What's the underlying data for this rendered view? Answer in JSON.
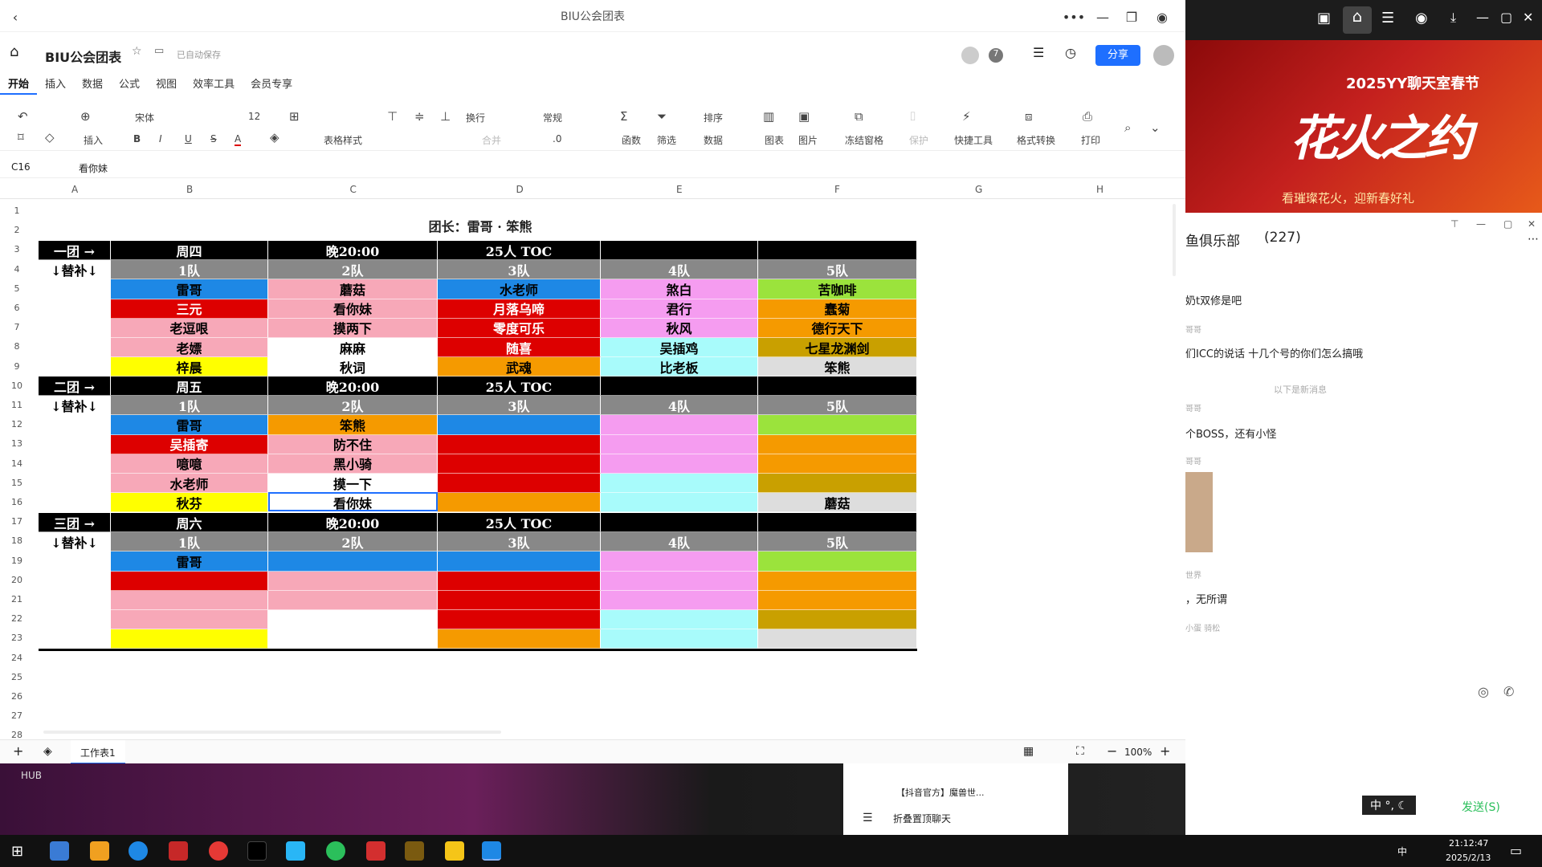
{
  "window": {
    "title": "BIU公会团表"
  },
  "doc": {
    "name": "BIU公会团表",
    "save_status": "已自动保存",
    "share_label": "分享",
    "collab_count": "7"
  },
  "menu": [
    "开始",
    "插入",
    "数据",
    "公式",
    "视图",
    "效率工具",
    "会员专享"
  ],
  "toolbar": {
    "insert": "插入",
    "font": "宋体",
    "size": "12",
    "b": "B",
    "i": "I",
    "u": "U",
    "s": "S",
    "a": "A",
    "table_style": "表格样式",
    "wrap": "换行",
    "merge": "合并",
    "format": "常规",
    "decimal": ".0",
    "func": "函数",
    "filter": "筛选",
    "sort": "排序",
    "data": "数据",
    "chart": "图表",
    "picture": "图片",
    "freeze": "冻结窗格",
    "protect": "保护",
    "quick": "快捷工具",
    "convert": "格式转换",
    "print": "打印"
  },
  "formula": {
    "ref": "C16",
    "value": "看你妹"
  },
  "columns": [
    "A",
    "B",
    "C",
    "D",
    "E",
    "F",
    "G",
    "H"
  ],
  "rows": [
    "1",
    "2",
    "3",
    "4",
    "5",
    "6",
    "7",
    "8",
    "9",
    "10",
    "11",
    "12",
    "13",
    "14",
    "15",
    "16",
    "17",
    "18",
    "19",
    "20",
    "21",
    "22",
    "23",
    "24",
    "25",
    "26",
    "27",
    "28"
  ],
  "sheet": {
    "title": "团长：雷哥 · 笨熊",
    "groups": [
      {
        "name": "一团 →",
        "day": "周四",
        "time": "晚20:00",
        "raid": "25人 TOC",
        "sub": "↓替补↓",
        "teams": [
          "1队",
          "2队",
          "3队",
          "4队",
          "5队"
        ],
        "rows": [
          [
            "雷哥",
            "蘑菇",
            "水老师",
            "煞白",
            "苦咖啡"
          ],
          [
            "三元",
            "看你妹",
            "月落乌啼",
            "君行",
            "蠢菊"
          ],
          [
            "老逗哏",
            "摸两下",
            "零度可乐",
            "秋风",
            "德行天下"
          ],
          [
            "老嫖",
            "麻麻",
            "随喜",
            "吴插鸡",
            "七星龙渊剑"
          ],
          [
            "梓晨",
            "秋词",
            "武魂",
            "比老板",
            "笨熊"
          ]
        ]
      },
      {
        "name": "二团 →",
        "day": "周五",
        "time": "晚20:00",
        "raid": "25人 TOC",
        "sub": "↓替补↓",
        "teams": [
          "1队",
          "2队",
          "3队",
          "4队",
          "5队"
        ],
        "rows": [
          [
            "雷哥",
            "笨熊",
            "",
            "",
            ""
          ],
          [
            "吴插寄",
            "防不住",
            "",
            "",
            ""
          ],
          [
            "噫噫",
            "黑小骑",
            "",
            "",
            ""
          ],
          [
            "水老师",
            "摸一下",
            "",
            "",
            ""
          ],
          [
            "秋芬",
            "看你妹",
            "",
            "",
            "蘑菇"
          ]
        ]
      },
      {
        "name": "三团 →",
        "day": "周六",
        "time": "晚20:00",
        "raid": "25人 TOC",
        "sub": "↓替补↓",
        "teams": [
          "1队",
          "2队",
          "3队",
          "4队",
          "5队"
        ],
        "rows": [
          [
            "雷哥",
            "",
            "",
            "",
            ""
          ],
          [
            "",
            "",
            "",
            "",
            ""
          ],
          [
            "",
            "",
            "",
            "",
            ""
          ],
          [
            "",
            "",
            "",
            "",
            ""
          ],
          [
            "",
            "",
            "",
            "",
            ""
          ]
        ]
      }
    ]
  },
  "colors": {
    "row_b": [
      "#1e88e5",
      "#dd0000",
      "#f7a8b8",
      "#f7a8b8",
      "#ffff00"
    ],
    "row_c": [
      "#f7a8b8",
      "#f7a8b8",
      "#f7a8b8",
      "#ffffff",
      "#ffffff"
    ],
    "row_c2": [
      "#f59a00",
      "#f7a8b8",
      "#f7a8b8",
      "#ffffff",
      "#ffffff"
    ],
    "row_c3": [
      "#1e88e5",
      "#f7a8b8",
      "#f7a8b8",
      "#ffffff",
      "#ffffff"
    ],
    "row_d": [
      "#1e88e5",
      "#dd0000",
      "#dd0000",
      "#dd0000",
      "#f59a00"
    ],
    "row_e": [
      "#f59cf0",
      "#f59cf0",
      "#f59cf0",
      "#a8fbfb",
      "#a8fbfb"
    ],
    "row_f": [
      "#9be33c",
      "#f59a00",
      "#f59a00",
      "#c9a000",
      "#dddddd"
    ]
  },
  "sheetbar": {
    "tab": "工作表1",
    "zoom": "100%"
  },
  "side": {
    "banner_title": "2025YY聊天室春节",
    "banner_big": "花火之约",
    "banner_sub": "看璀璨花火，迎新春好礼",
    "room": "鱼俱乐部",
    "count": "(227)",
    "messages": [
      "奶t双修是吧",
      "们ICC的说话 十几个号的你们怎么搞哦",
      "以下是新消息",
      "个BOSS，还有小怪",
      "，无所谓"
    ],
    "small": [
      "哥哥",
      "哥哥",
      "哥哥",
      "世界",
      "小蛋 骑松"
    ],
    "send": "发送(S)",
    "fold": "折叠置顶聊天",
    "dy": "【抖音官方】魔兽世...",
    "ime": "中 °, ☾"
  },
  "bottom": {
    "hub": "HUB"
  },
  "taskbar": {
    "time": "21:12:47",
    "date": "2025/2/13",
    "ime": "中"
  }
}
